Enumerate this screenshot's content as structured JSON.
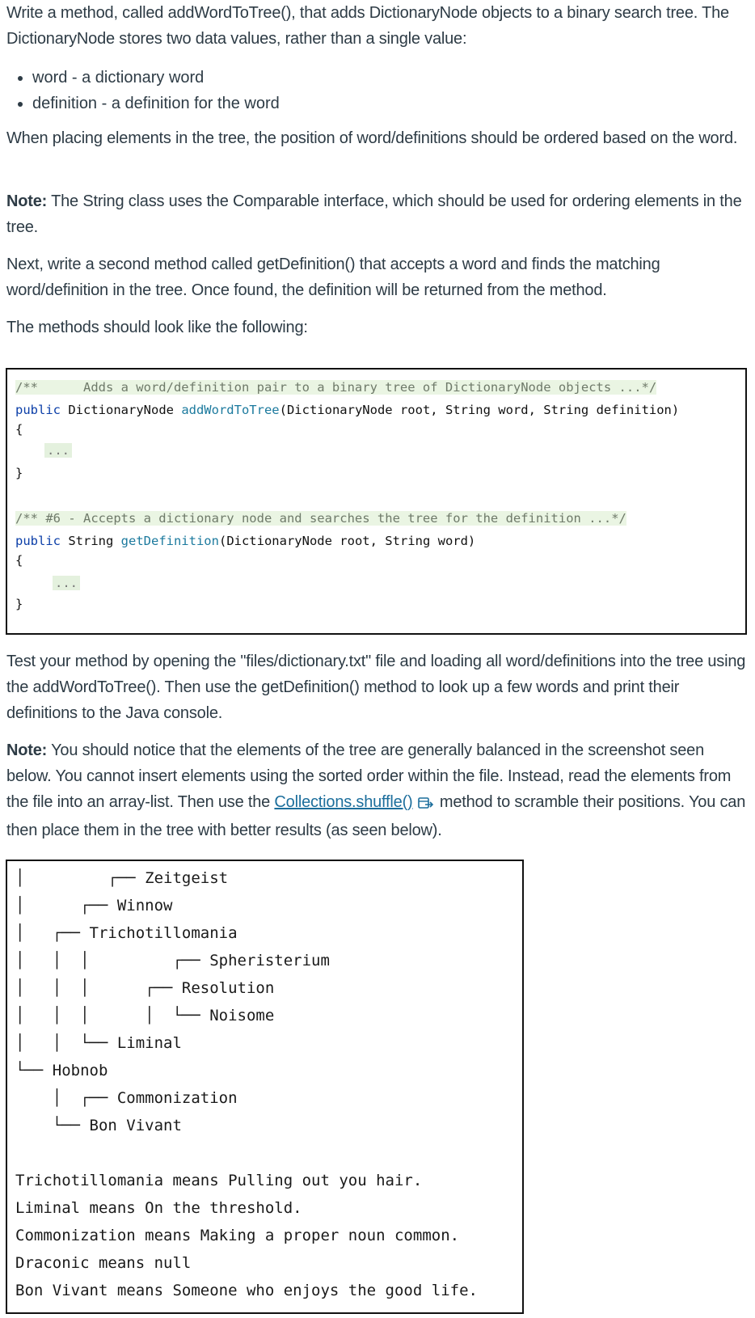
{
  "intro": {
    "p1": "Write a method, called addWordToTree(), that adds DictionaryNode objects to a binary search tree. The DictionaryNode stores two data values, rather than a single value:",
    "bullets": [
      "word - a dictionary word",
      "definition - a definition for the word"
    ],
    "p2": "When placing elements in the tree, the position of word/definitions should be ordered based on the word.",
    "note1_label": "Note:",
    "note1_text": " The String class uses the Comparable interface, which should be used for ordering elements in the tree.",
    "p3": "Next, write a second method called getDefinition() that accepts a word and finds the matching word/definition in the tree. Once found, the definition will be returned from the method.",
    "p4": "The methods should look like the following:"
  },
  "code": {
    "comment1": "/**      Adds a word/definition pair to a binary tree of DictionaryNode objects ...*/",
    "sig1_kw": "public",
    "sig1_type": " DictionaryNode ",
    "sig1_fn": "addWordToTree",
    "sig1_params": "(DictionaryNode root, String word, String definition)",
    "open1": "{",
    "fold1": "...",
    "close1": "}",
    "comment2": "/** #6 - Accepts a dictionary node and searches the tree for the definition ...*/",
    "sig2_kw": "public",
    "sig2_type": " String ",
    "sig2_fn": "getDefinition",
    "sig2_params": "(DictionaryNode root, String word)",
    "open2": "{",
    "fold2": "...",
    "close2": "}"
  },
  "test": {
    "p5": "Test your method by opening the \"files/dictionary.txt\" file and loading all word/definitions into the tree using the addWordToTree(). Then use the getDefinition() method to look up a few words and print their definitions to the Java console.",
    "note2_label": "Note:",
    "note2_text_before": " You should notice that the elements of the tree are generally balanced in the screenshot seen below. You cannot insert elements using the sorted order within the file. Instead, read the elements from the file into an array-list. Then use the ",
    "link_text": "Collections.shuffle()",
    "link_icon": "external-link-icon",
    "note2_text_after": " method to scramble their positions. You can then place them in the tree with better results (as seen below)."
  },
  "output": {
    "tree_lines": [
      "│         ┌── Zeitgeist",
      "│      ┌── Winnow",
      "│   ┌── Trichotillomania",
      "│   │  │         ┌── Spheristerium",
      "│   │  │      ┌── Resolution",
      "│   │  │      │  └── Noisome",
      "│   │  └── Liminal",
      "└── Hobnob",
      "    │  ┌── Commonization",
      "    └── Bon Vivant"
    ],
    "console_lines": [
      "Trichotillomania means Pulling out you hair.",
      "Liminal means On the threshold.",
      "Commonization means Making a proper noun common.",
      "Draconic means null",
      "Bon Vivant means Someone who enjoys the good life."
    ]
  }
}
